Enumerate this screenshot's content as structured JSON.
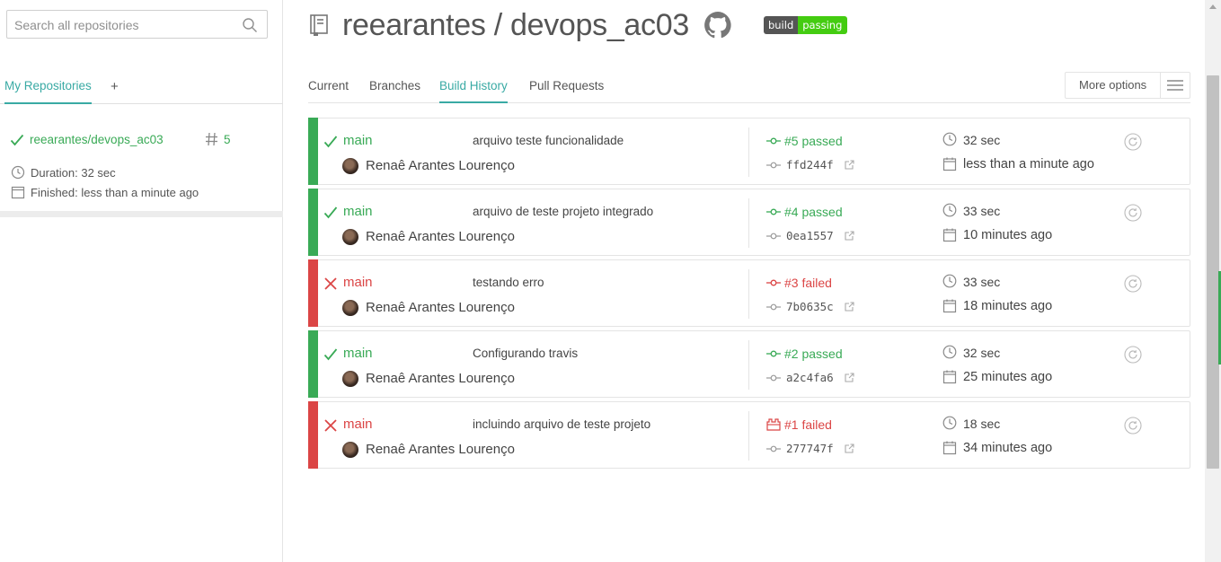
{
  "search": {
    "placeholder": "Search all repositories"
  },
  "sidebar": {
    "tab_active": "My Repositories",
    "tab_add": "+",
    "repo": {
      "name": "reearantes/devops_ac03",
      "build_number": "5",
      "duration": "Duration: 32 sec",
      "finished": "Finished: less than a minute ago"
    }
  },
  "header": {
    "title": "reearantes / devops_ac03",
    "badge_left": "build",
    "badge_right": "passing"
  },
  "tabs": [
    {
      "label": "Current"
    },
    {
      "label": "Branches"
    },
    {
      "label": "Build History"
    },
    {
      "label": "Pull Requests"
    }
  ],
  "more_options": {
    "label": "More options"
  },
  "builds": [
    {
      "status": "passed",
      "branch": "main",
      "message": "arquivo teste funcionalidade",
      "author": "Renaê Arantes Lourenço",
      "number": "#5 passed",
      "commit": "ffd244f",
      "duration": "32 sec",
      "finished": "less than a minute ago"
    },
    {
      "status": "passed",
      "branch": "main",
      "message": "arquivo de teste projeto integrado",
      "author": "Renaê Arantes Lourenço",
      "number": "#4 passed",
      "commit": "0ea1557",
      "duration": "33 sec",
      "finished": "10 minutes ago"
    },
    {
      "status": "failed",
      "branch": "main",
      "message": "testando erro",
      "author": "Renaê Arantes Lourenço",
      "number": "#3 failed",
      "commit": "7b0635c",
      "duration": "33 sec",
      "finished": "18 minutes ago"
    },
    {
      "status": "passed",
      "branch": "main",
      "message": "Configurando travis",
      "author": "Renaê Arantes Lourenço",
      "number": "#2 passed",
      "commit": "a2c4fa6",
      "duration": "32 sec",
      "finished": "25 minutes ago"
    },
    {
      "status": "failed",
      "branch": "main",
      "message": "incluindo arquivo de teste projeto",
      "author": "Renaê Arantes Lourenço",
      "number": "#1 failed",
      "commit": "277747f",
      "duration": "18 sec",
      "finished": "34 minutes ago"
    }
  ],
  "colors": {
    "passed": "#39aa56",
    "failed": "#db4545",
    "accent": "#39aaa4"
  },
  "icons": {
    "repo": "repo-icon",
    "github": "github-icon",
    "search": "search-icon",
    "duration": "clock-icon",
    "finished": "calendar-icon",
    "restart": "restart-icon"
  }
}
